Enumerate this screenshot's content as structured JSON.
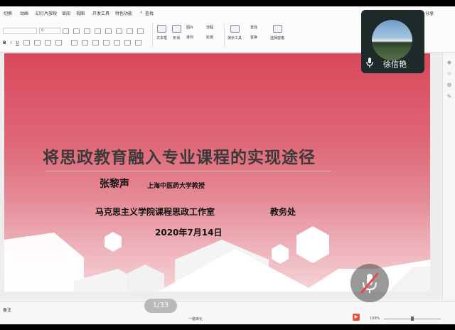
{
  "ribbon": {
    "tabs": [
      "切换",
      "动画",
      "幻灯片放映",
      "审阅",
      "视图",
      "开发工具",
      "特色功能",
      "查找"
    ],
    "right_label": "分享",
    "font_size_value": "0",
    "groups": [
      {
        "label": "文本框",
        "icon": "textbox-icon"
      },
      {
        "label": "形状",
        "icon": "shape-icon"
      },
      {
        "label": "图片",
        "icon": "picture-icon"
      },
      {
        "label": "排列",
        "icon": "arrange-icon"
      },
      {
        "label": "演示工具",
        "icon": "presentation-tools-icon"
      },
      {
        "label": "替换",
        "icon": "replace-icon"
      },
      {
        "label": "选择窗格",
        "icon": "selection-pane-icon"
      }
    ],
    "small_items": [
      "流程",
      "轮廓",
      "查找"
    ]
  },
  "slide": {
    "title": "将思政教育融入专业课程的实现途径",
    "author": "张黎声",
    "affiliation": "上海中医药大学教授",
    "organization": "马克思主义学院课程思政工作室",
    "department": "教务处",
    "date": "2020年7月14日",
    "background_top": "#d9485c",
    "background_bottom": "#f5d4d8"
  },
  "status_bar": {
    "notes_label": "备注",
    "view_mode": "一键美化",
    "zoom": "108%"
  },
  "page_indicator": "1/33",
  "video": {
    "participant_name": "徐信艳",
    "mic_state": "on"
  },
  "mute_button": {
    "icon": "mic-muted-icon"
  }
}
